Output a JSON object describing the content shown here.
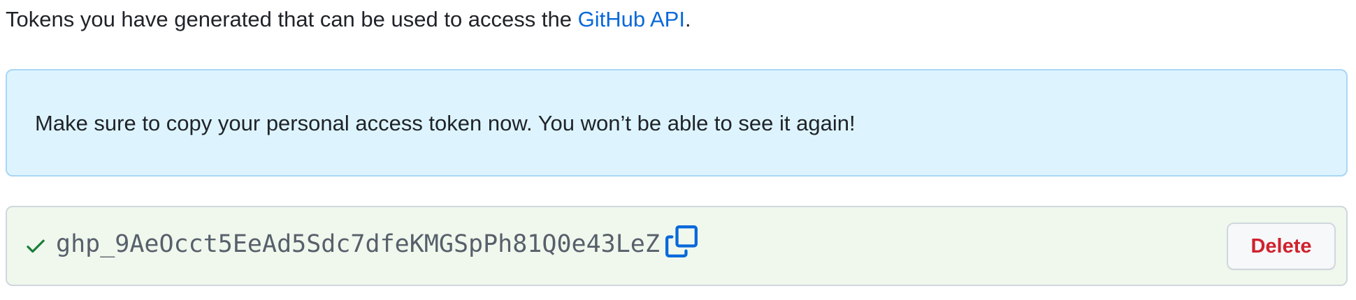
{
  "intro": {
    "text_before": "Tokens you have generated that can be used to access the ",
    "link_text": "GitHub API",
    "text_after": "."
  },
  "flash": {
    "message": "Make sure to copy your personal access token now. You won’t be able to see it again!"
  },
  "token_row": {
    "status_icon": "check-icon",
    "token_value": "ghp_9AeOcct5EeAd5Sdc7dfeKMGSpPh81Q0e43LeZ",
    "copy_icon": "copy-icon",
    "delete_label": "Delete"
  },
  "colors": {
    "link": "#0969da",
    "flash_bg": "#ddf4ff",
    "flash_border": "#a9d6f5",
    "token_row_bg": "#f0f8ee",
    "check": "#1a7f37",
    "danger": "#cf222e"
  }
}
